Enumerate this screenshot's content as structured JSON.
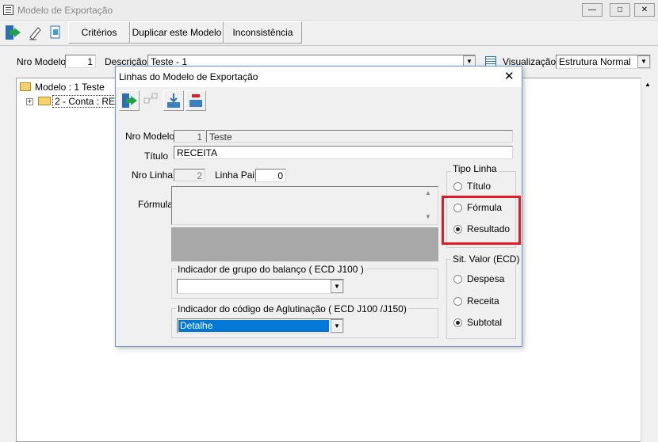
{
  "window": {
    "title": "Modelo de Exportação"
  },
  "toolbar": {
    "criterios": "Critérios",
    "duplicar": "Duplicar este Modelo",
    "inconsistencia": "Inconsistência"
  },
  "filters": {
    "nro_modelo_label": "Nro Modelo",
    "nro_modelo_value": "1",
    "descricao_label": "Descrição",
    "descricao_value": "Teste - 1",
    "visualizacao_label": "Visualização",
    "visualizacao_value": "Estrutura Normal"
  },
  "tree": {
    "root": "Modelo : 1 Teste",
    "child": "2 - Conta   : REC"
  },
  "dialog": {
    "title": "Linhas do Modelo de Exportação",
    "nro_modelo_label": "Nro Modelo",
    "nro_modelo_value": "1",
    "nro_modelo_name": "Teste",
    "titulo_label": "Título",
    "titulo_value": "RECEITA",
    "nro_linha_label": "Nro Linha",
    "nro_linha_value": "2",
    "linha_pai_label": "Linha Pai",
    "linha_pai_value": "0",
    "formula_label": "Fórmula",
    "formula_value": "",
    "grupo_balanco_label": "Indicador de grupo do balanço ( ECD J100 )",
    "grupo_balanco_value": "",
    "aglutinacao_label": "Indicador do código de Aglutinação ( ECD J100 /J150)",
    "aglutinacao_value": "Detalhe",
    "tipo_linha": {
      "label": "Tipo Linha",
      "options": [
        "Título",
        "Fórmula",
        "Resultado"
      ],
      "selected": "Resultado"
    },
    "sit_valor": {
      "label": "Sit. Valor (ECD)",
      "options": [
        "Despesa",
        "Receita",
        "Subtotal"
      ],
      "selected": "Subtotal"
    }
  },
  "colors": {
    "highlight": "#e21b24",
    "selection": "#0078d7",
    "dialog_border": "#6a9ac8"
  }
}
